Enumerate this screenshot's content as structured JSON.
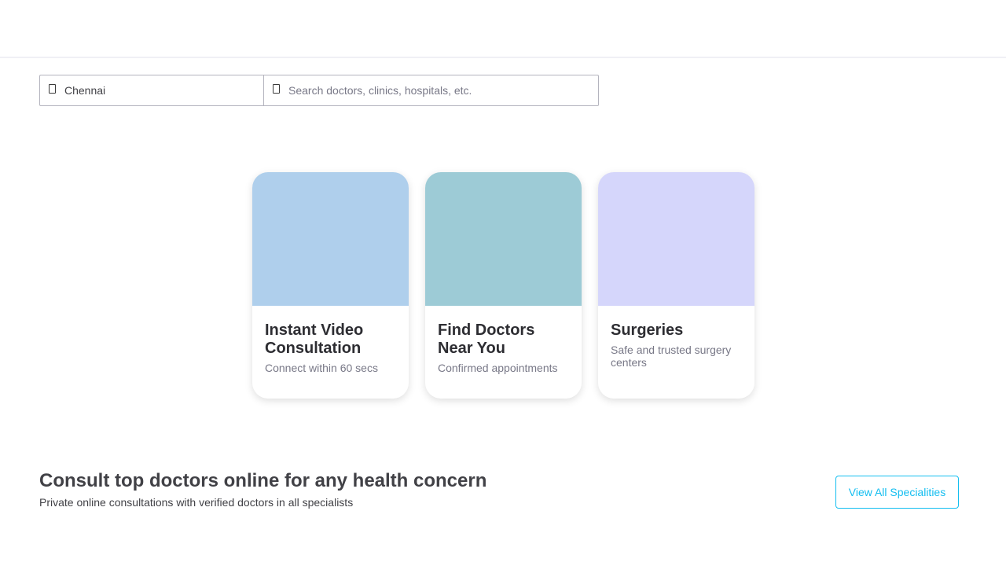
{
  "search": {
    "location_value": "Chennai",
    "location_icon": "location-icon",
    "query_placeholder": "Search doctors, clinics, hospitals, etc.",
    "query_icon": "search-icon"
  },
  "cards": [
    {
      "title": "Instant Video Consultation",
      "subtitle": "Connect within 60 secs",
      "color": "#afcfec"
    },
    {
      "title": "Find Doctors Near You",
      "subtitle": "Confirmed appointments",
      "color": "#9dcbd6"
    },
    {
      "title": "Surgeries",
      "subtitle": "Safe and trusted surgery centers",
      "color": "#d5d6fb"
    }
  ],
  "consult": {
    "title": "Consult top doctors online for any health concern",
    "subtitle": "Private online consultations with verified doctors in all specialists",
    "button_label": "View All Specialities"
  },
  "colors": {
    "accent": "#14bef0",
    "text_dark": "#2d2d32",
    "text_muted": "#787887"
  }
}
